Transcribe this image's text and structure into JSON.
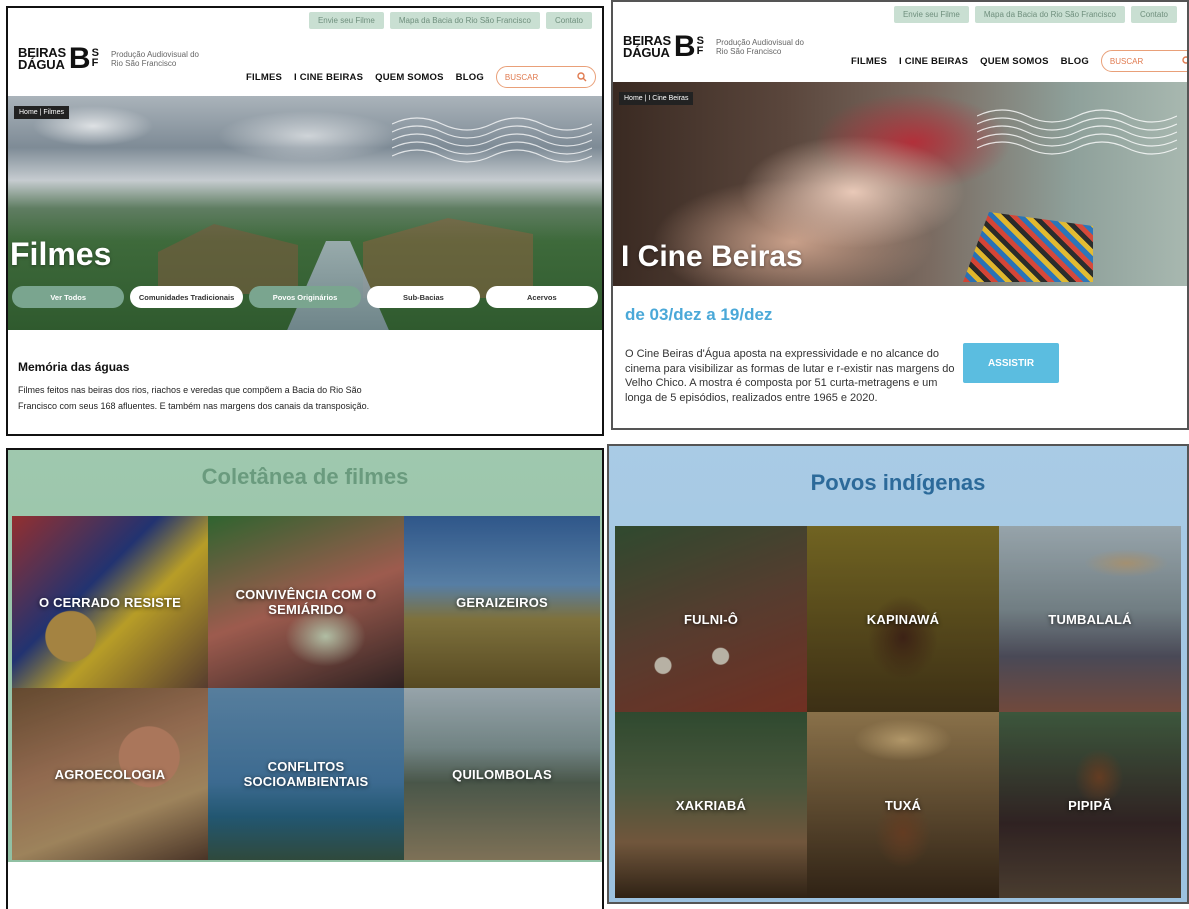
{
  "header": {
    "top_links": [
      "Envie seu Filme",
      "Mapa da Bacia do Rio São Francisco",
      "Contato"
    ],
    "logo": {
      "line1": "BEIRAS",
      "line2": "DÁGUA",
      "mark_b": "B",
      "mark_s": "S",
      "mark_f": "F"
    },
    "tagline": "Produção Audiovisual do Rio São Francisco",
    "nav": [
      "FILMES",
      "I CINE BEIRAS",
      "QUEM SOMOS",
      "BLOG"
    ],
    "search_placeholder": "BUSCAR"
  },
  "filmes_page": {
    "breadcrumb": "Home | Filmes",
    "hero_title": "Filmes",
    "filters": [
      "Ver Todos",
      "Comunidades Tradicionais",
      "Povos Originários",
      "Sub-Bacias",
      "Acervos"
    ],
    "section_heading": "Memória das águas",
    "section_text": "Filmes feitos nas beiras dos rios, riachos e veredas que compõem a Bacia do Rio São Francisco com seus 168 afluentes. E também nas margens dos canais da transposição."
  },
  "cine_page": {
    "breadcrumb": "Home | I Cine Beiras",
    "hero_title": "I Cine Beiras",
    "date_range": "de 03/dez a 19/dez",
    "description": "O Cine Beiras d'Água aposta na expressividade e no alcance do cinema para visibilizar as formas de lutar e r-existir nas margens do Velho Chico. A mostra é composta por 51 curta-metragens e um longa de 5 episódios, realizados entre 1965 e 2020.",
    "button": "ASSISTIR"
  },
  "coletanea": {
    "title": "Coletânea de filmes",
    "tiles": [
      "O CERRADO RESISTE",
      "CONVIVÊNCIA COM O SEMIÁRIDO",
      "GERAIZEIROS",
      "AGROECOLOGIA",
      "CONFLITOS SOCIOAMBIENTAIS",
      "QUILOMBOLAS"
    ]
  },
  "povos": {
    "title": "Povos indígenas",
    "tiles": [
      "FULNI-Ô",
      "KAPINAWÁ",
      "TUMBALALÁ",
      "XAKRIABÁ",
      "TUXÁ",
      "PIPIPÃ"
    ]
  },
  "colors": {
    "green_accent": "#7aa58f",
    "blue_accent": "#4aa8d8",
    "search_border": "#e9a079",
    "coletanea_title": "#6a9b7e",
    "povos_title": "#2c6a9a"
  }
}
